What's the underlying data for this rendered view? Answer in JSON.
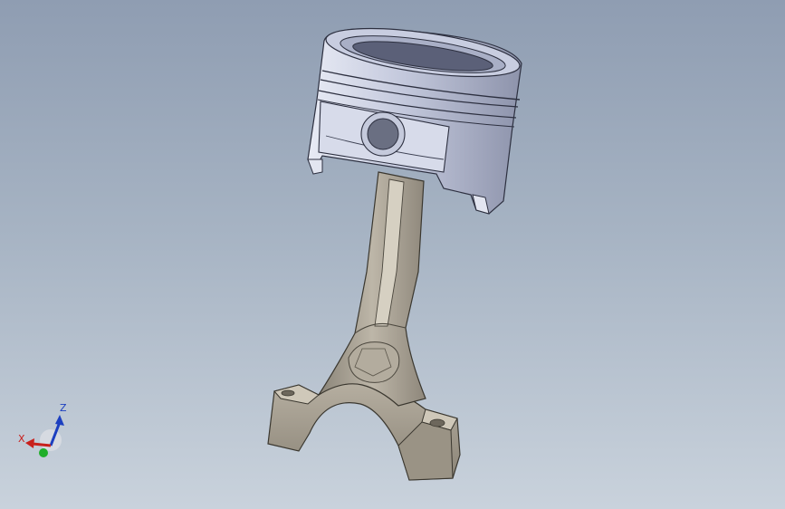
{
  "viewport": {
    "background_top": "#8f9db2",
    "background_bottom": "#c9d2dc"
  },
  "model": {
    "description_icon": "piston-connecting-rod-assembly",
    "piston_color": "#b9bfd6",
    "rod_color": "#a69f92"
  },
  "triad": {
    "x_label": "X",
    "y_label": "",
    "z_label": "Z",
    "x_color": "#c8201c",
    "y_color": "#1fae2a",
    "z_color": "#1c3fc0"
  }
}
